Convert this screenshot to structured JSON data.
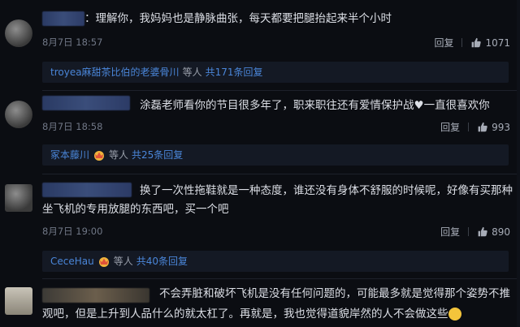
{
  "comments": [
    {
      "text": "：理解你，我妈妈也是静脉曲张，每天都要把腿抬起来半个小时",
      "date": "8月7日 18:57",
      "reply_label": "回复",
      "likes": "1071",
      "thread": {
        "user": "troyea麻甜茶比伯的老婆骨川",
        "suffix": "等人",
        "count": "共171条回复"
      }
    },
    {
      "text": "涂磊老师看你的节目很多年了，职来职往还有爱情保护战♥一直很喜欢你",
      "date": "8月7日 18:58",
      "reply_label": "回复",
      "likes": "993",
      "thread": {
        "user": "冢本藤川",
        "suffix": "等人",
        "count": "共25条回复"
      }
    },
    {
      "text_line1": "换了一次性拖鞋就是一种态度，谁还没有身体不舒服的时候呢，好像有买那种",
      "text_line2": "坐飞机的专用放腿的东西吧，买一个吧",
      "date": "8月7日 19:00",
      "reply_label": "回复",
      "likes": "890",
      "thread": {
        "user": "CeceHau",
        "suffix": "等人",
        "count": "共40条回复"
      }
    },
    {
      "text_line1": "不会弄脏和破坏飞机是没有任何问题的，可能最多就是觉得那个姿势不推",
      "text_line2": "观吧，但是上升到人品什么的就太杠了。再就是，我也觉得道貌岸然的人不会做这些"
    }
  ],
  "icons": {
    "like": "thumbs-up-icon",
    "crown": "crown-badge-icon"
  },
  "colors": {
    "background": "#0b0d12",
    "link": "#4a86d9",
    "muted": "#707786"
  }
}
